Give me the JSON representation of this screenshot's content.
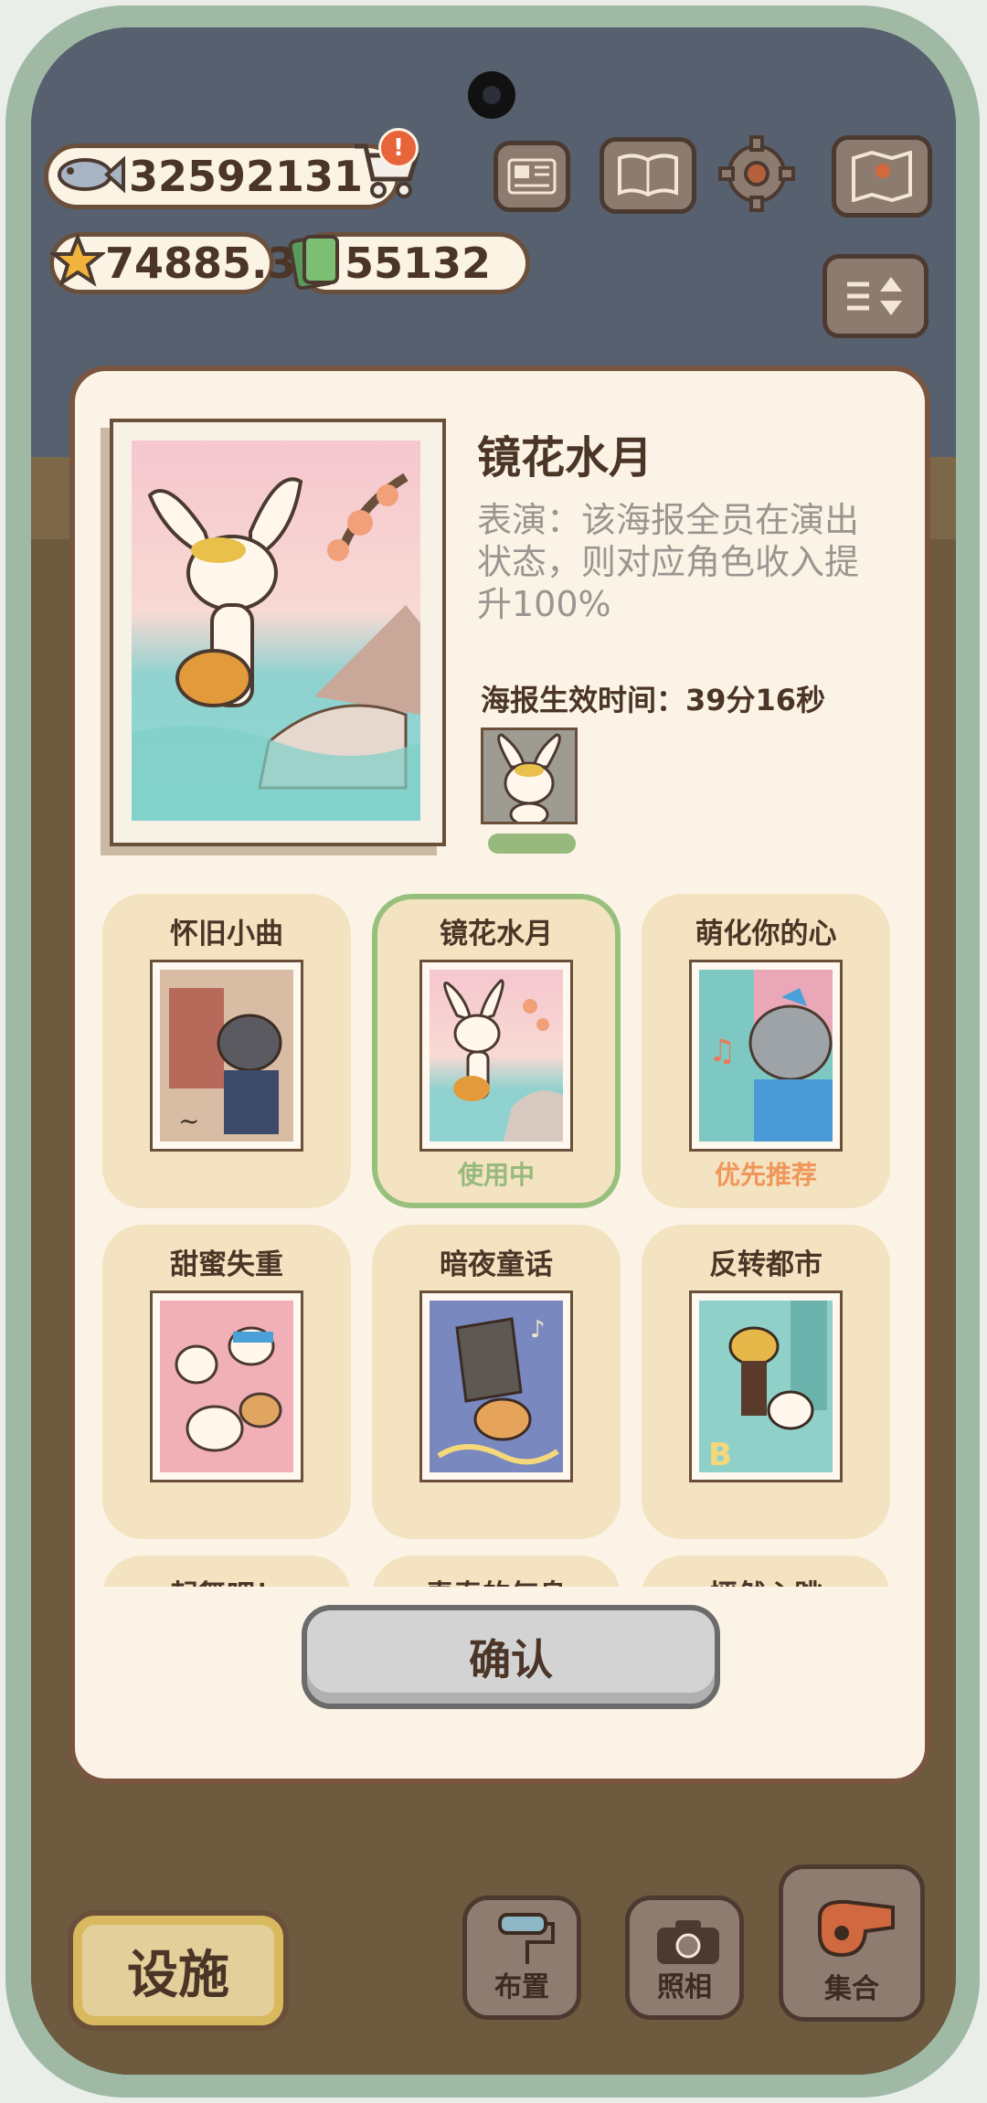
{
  "hud": {
    "fish_count": "32592131",
    "star_count": "74885.3",
    "ticket_count": "55132"
  },
  "icons": {
    "fish": "fish-icon",
    "cart": "shopping-cart-icon",
    "notice": "exclamation-badge-icon",
    "star": "star-icon",
    "ticket": "ticket-icon",
    "newspaper": "newspaper-icon",
    "book": "book-icon",
    "settings": "gear-icon",
    "map": "map-icon",
    "toggle": "sort-toggle-icon"
  },
  "poster": {
    "title": "镜花水月",
    "description": "表演：该海报全员在演出状态，则对应角色收入提升100%",
    "timer": "海报生效时间：39分16秒",
    "effect_progress": 1.0
  },
  "cards": [
    {
      "title": "怀旧小曲",
      "tag": "",
      "tag_color": "",
      "bg": "#c9a48c"
    },
    {
      "title": "镜花水月",
      "tag": "使用中",
      "tag_color": "#98b97d",
      "bg": "#f3c6cb"
    },
    {
      "title": "萌化你的心",
      "tag": "优先推荐",
      "tag_color": "#f0965a",
      "bg": "#7ec8c4"
    },
    {
      "title": "甜蜜失重",
      "tag": "",
      "tag_color": "",
      "bg": "#7ccfc4"
    },
    {
      "title": "暗夜童话",
      "tag": "",
      "tag_color": "",
      "bg": "#6f7fb8"
    },
    {
      "title": "反转都市",
      "tag": "",
      "tag_color": "",
      "bg": "#8fd0c8"
    },
    {
      "title": "起舞吧！",
      "tag": "",
      "tag_color": "",
      "bg": "#f0d8a8"
    },
    {
      "title": "青春的气息",
      "tag": "",
      "tag_color": "",
      "bg": "#f0d8a8"
    },
    {
      "title": "怦然心跳",
      "tag": "",
      "tag_color": "",
      "bg": "#f0d8a8"
    }
  ],
  "confirm_label": "确认",
  "bottom": {
    "facility": "设施",
    "layout": "布置",
    "photo": "照相",
    "gather": "集合"
  }
}
